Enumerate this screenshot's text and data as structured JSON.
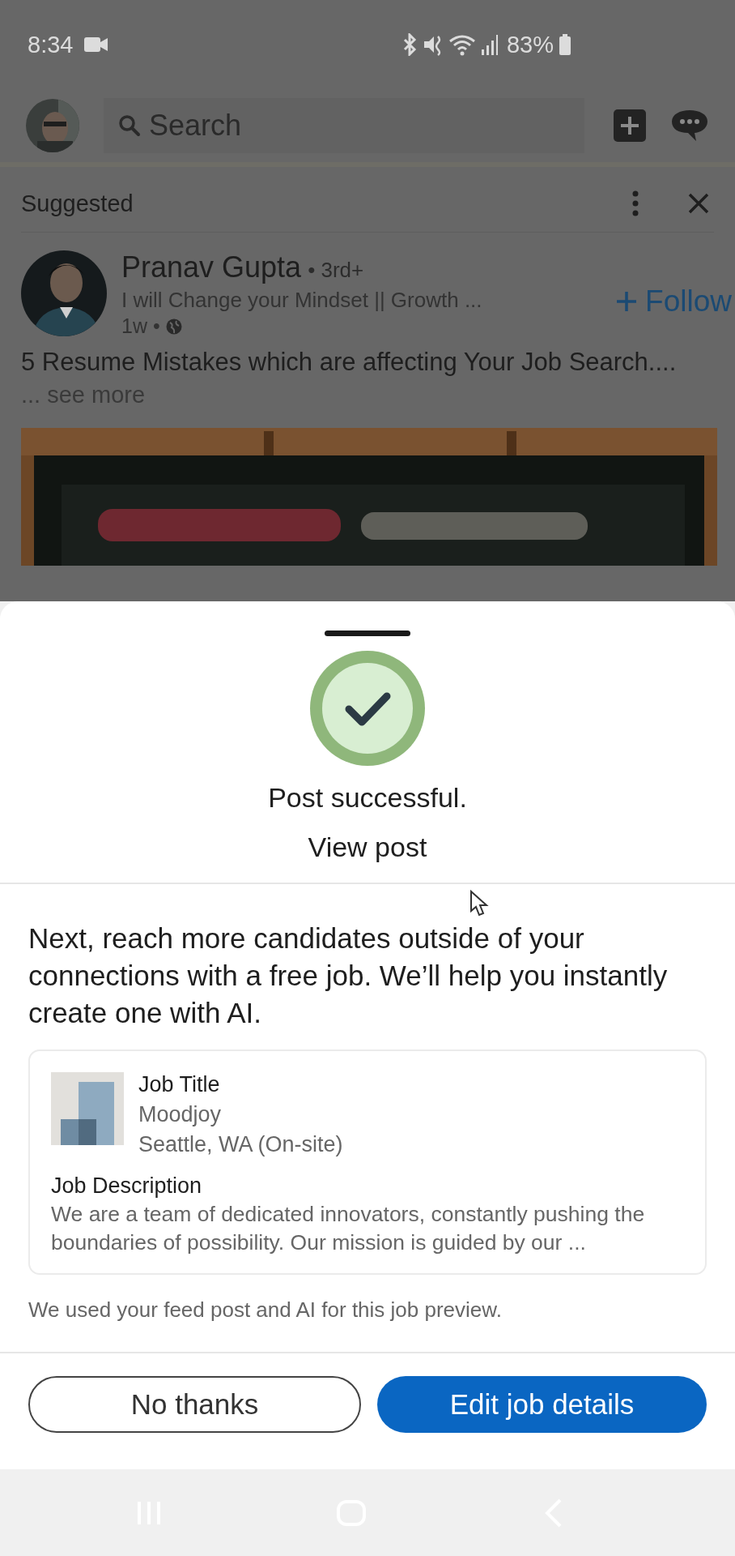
{
  "status_bar": {
    "time": "8:34",
    "battery": "83%"
  },
  "header": {
    "search": {
      "placeholder": "Search"
    }
  },
  "feed_card": {
    "label": "Suggested",
    "author": {
      "name": "Pranav Gupta",
      "degree": "• 3rd+",
      "headline": "I will Change your Mindset || Growth ...",
      "time": "1w •"
    },
    "follow": "Follow",
    "post_text": "5 Resume Mistakes which are affecting Your Job Search....",
    "see_more": "... see more"
  },
  "sheet": {
    "title": "Post successful.",
    "link": "View post",
    "message": "Next, reach more candidates outside of your connections with a free job. We’ll help you instantly create one with AI.",
    "job_preview": {
      "title": "Job Title",
      "company": "Moodjoy",
      "location": "Seattle, WA (On-site)",
      "description_label": "Job Description",
      "description": "We are a team of dedicated innovators, constantly pushing the boundaries of possibility. Our mission is guided by our ..."
    },
    "note": "We used your feed post and AI for this job preview.",
    "buttons": [
      {
        "label": "No thanks",
        "kind": "secondary"
      },
      {
        "label": "Edit job details",
        "kind": "primary"
      }
    ]
  }
}
